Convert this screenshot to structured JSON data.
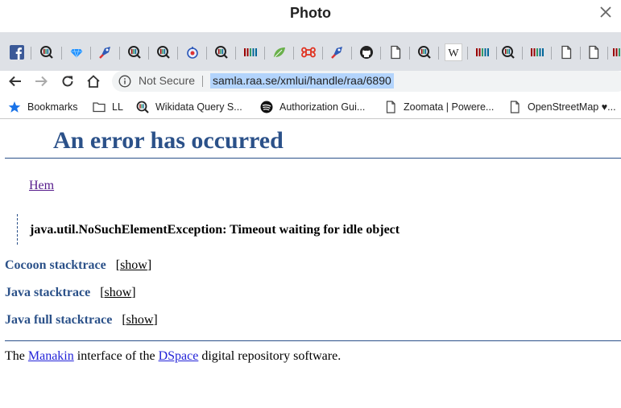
{
  "window": {
    "title": "Photo",
    "close_icon": "close-icon"
  },
  "tabs": [
    {
      "icon": "facebook-icon"
    },
    {
      "icon": "wikidata-query-icon"
    },
    {
      "icon": "diamond-icon"
    },
    {
      "icon": "rocket-icon"
    },
    {
      "icon": "wikidata-query-icon"
    },
    {
      "icon": "wikidata-query-icon"
    },
    {
      "icon": "wikipedia-w-globe-icon"
    },
    {
      "icon": "wikidata-query-icon"
    },
    {
      "icon": "wikidata-barcode-icon"
    },
    {
      "icon": "leaf-icon"
    },
    {
      "icon": "command-icon"
    },
    {
      "icon": "rocket-icon"
    },
    {
      "icon": "github-icon"
    },
    {
      "icon": "page-icon"
    },
    {
      "icon": "wikidata-query-icon"
    },
    {
      "icon": "wikipedia-icon"
    },
    {
      "icon": "wikidata-barcode-icon"
    },
    {
      "icon": "wikidata-query-icon"
    },
    {
      "icon": "wikidata-barcode-icon"
    },
    {
      "icon": "page-icon"
    },
    {
      "icon": "page-icon"
    },
    {
      "icon": "wikidata-barcode-icon"
    }
  ],
  "toolbar": {
    "security_label": "Not Secure",
    "url": "samla.raa.se/xmlui/handle/raa/6890"
  },
  "bookmarks": [
    {
      "label": "Bookmarks",
      "icon": "star-icon"
    },
    {
      "label": "LL",
      "icon": "folder-icon"
    },
    {
      "label": "Wikidata Query S...",
      "icon": "wikidata-query-icon"
    },
    {
      "label": "Authorization Gui...",
      "icon": "spotify-icon"
    },
    {
      "label": "Zoomata | Powere...",
      "icon": "page-icon"
    },
    {
      "label": "OpenStreetMap ♥...",
      "icon": "page-icon"
    }
  ],
  "page": {
    "heading": "An error has occurred",
    "home_link": "Hem",
    "error_message": "java.util.NoSuchElementException: Timeout waiting for idle object",
    "traces": [
      {
        "label": "Cocoon stacktrace",
        "bracket_open": "[",
        "show": "show",
        "bracket_close": "]"
      },
      {
        "label": "Java stacktrace",
        "bracket_open": "[",
        "show": "show",
        "bracket_close": "]"
      },
      {
        "label": "Java full stacktrace",
        "bracket_open": "[",
        "show": "show",
        "bracket_close": "]"
      }
    ],
    "footer": {
      "prefix": "The ",
      "manakin": "Manakin",
      "middle": " interface of the ",
      "dspace": "DSpace",
      "suffix": " digital repository software."
    }
  },
  "colors": {
    "heading": "#2b5189",
    "tabstrip": "#dee1e6",
    "url_highlight": "#b3d4fc",
    "visited_link": "#551a8b"
  }
}
